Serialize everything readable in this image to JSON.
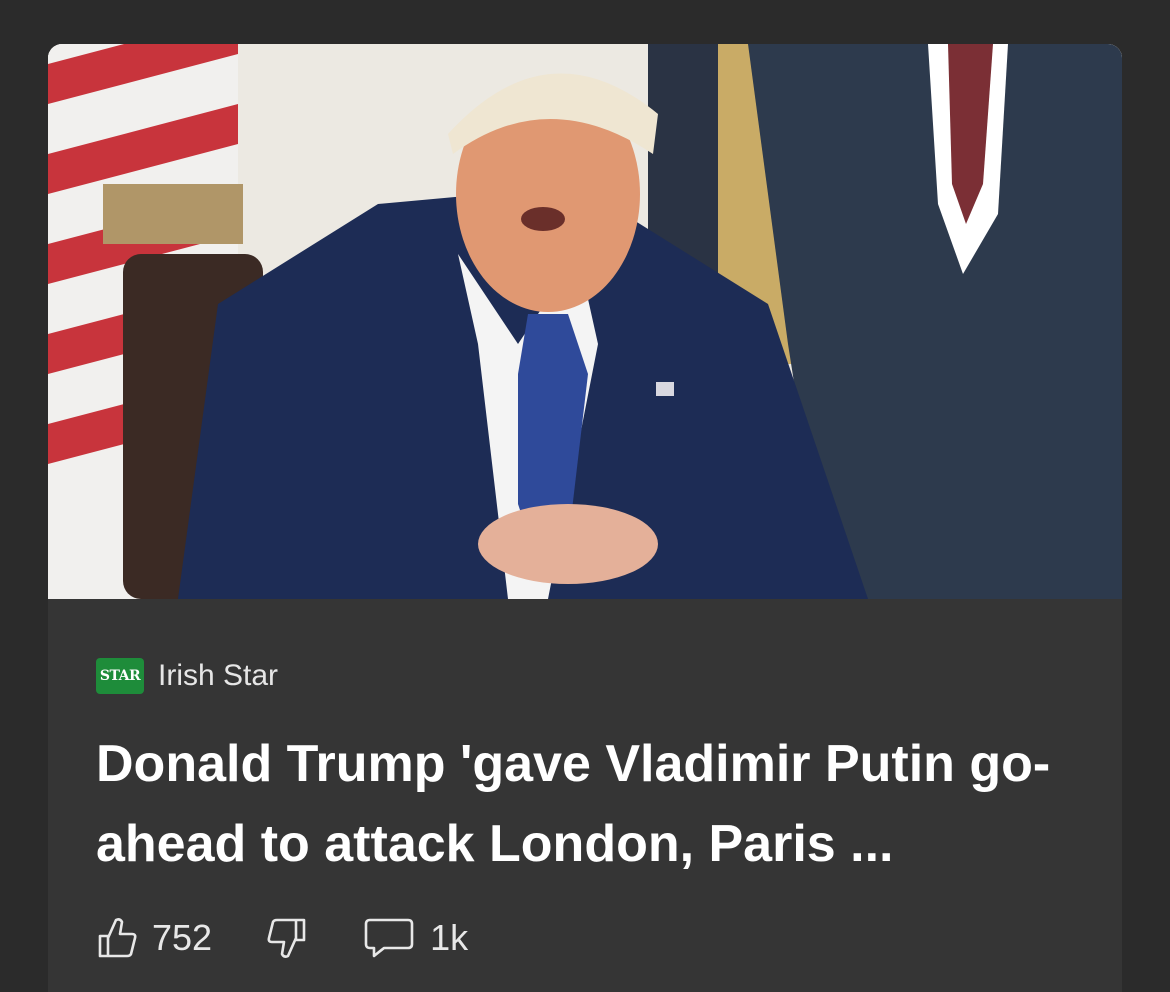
{
  "article": {
    "image_alt": "Donald Trump seated at desk",
    "source": {
      "logo_text": "STAR",
      "logo_icon": "irish-star-logo",
      "name": "Irish Star",
      "brand_color": "#1e8c3a"
    },
    "headline": "Donald Trump 'gave Vladimir Putin go-ahead to attack London, Paris ...",
    "reactions": {
      "like_icon": "thumbs-up-icon",
      "like_count": "752",
      "dislike_icon": "thumbs-down-icon",
      "comment_icon": "comment-icon",
      "comment_count": "1k"
    }
  },
  "colors": {
    "page_background": "#2b2b2b",
    "card_background": "#353535",
    "text_primary": "#ffffff",
    "text_secondary": "#e6e6e6"
  }
}
